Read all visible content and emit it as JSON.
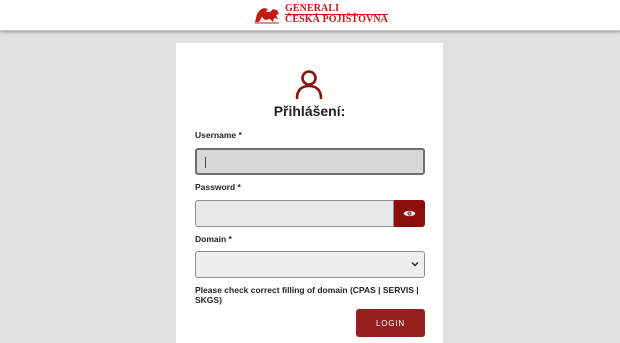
{
  "header": {
    "brand_line1": "GENERALI",
    "brand_line2": "ČESKÁ POJIŠŤOVNA",
    "brand_color": "#c21b17"
  },
  "login": {
    "title": "Přihlášení:",
    "user_icon": "user-icon",
    "username_label": "Username *",
    "username_value": "",
    "password_label": "Password *",
    "password_value": "",
    "show_password_icon": "eye-icon",
    "domain_label": "Domain *",
    "domain_value": "",
    "domain_hint": "Please check correct filling of domain (CPAS | SERVIS | SKGS)",
    "login_button": "LOGIN",
    "accent_color": "#8b0e0b"
  }
}
